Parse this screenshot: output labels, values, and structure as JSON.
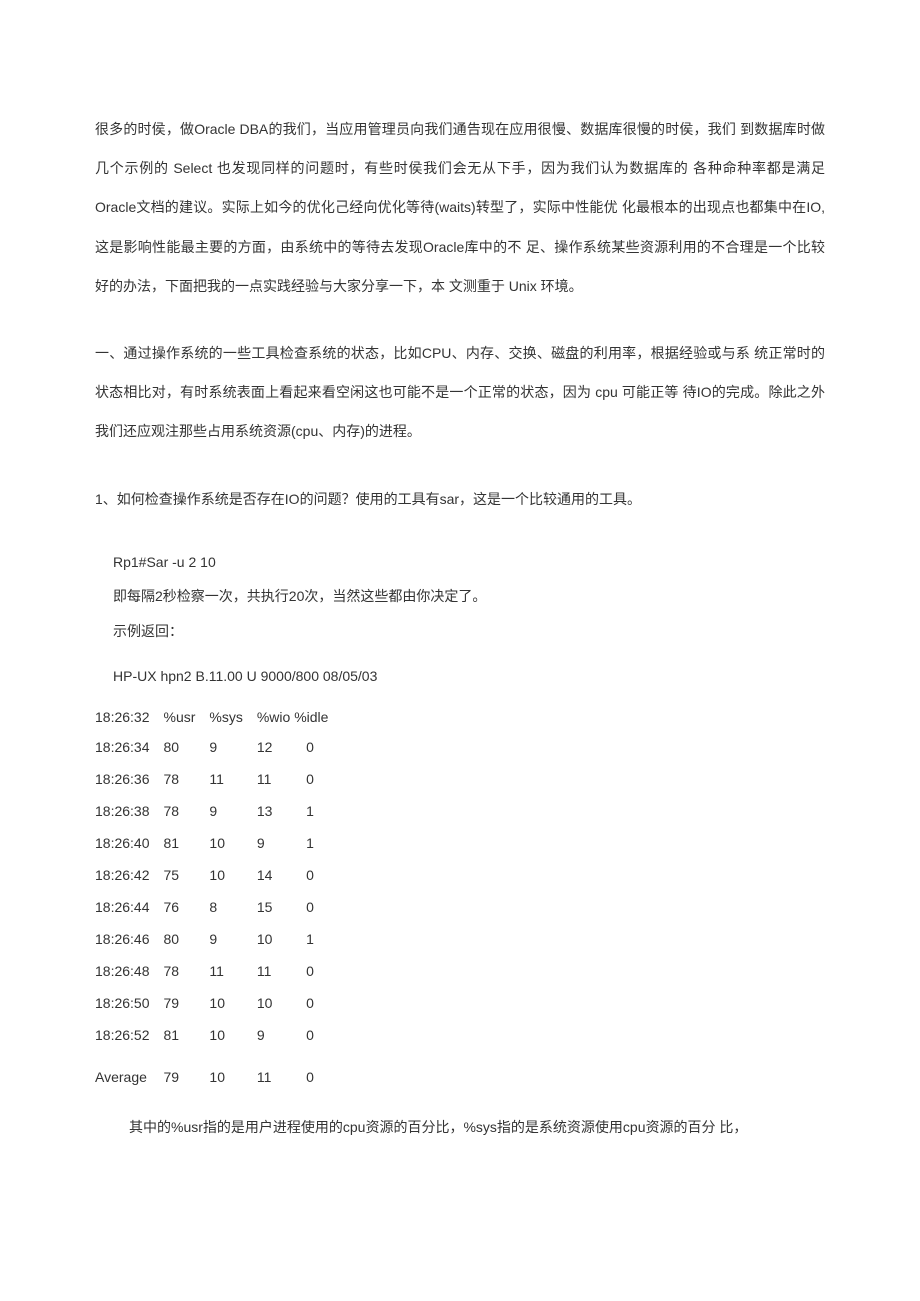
{
  "p1": "很多的时侯，做Oracle DBA的我们，当应用管理员向我们通告现在应用很慢、数据库很慢的时侯，我们  到数据库时做几个示例的  Select 也发现同样的问题时，有些时侯我们会无从下手，因为我们认为数据库的  各种命种率都是满足Oracle文档的建议。实际上如今的优化己经向优化等待(waits)转型了，实际中性能优  化最根本的出现点也都集中在IO,这是影响性能最主要的方面，由系统中的等待去发现Oracle库中的不  足、操作系统某些资源利用的不合理是一个比较好的办法，下面把我的一点实践经验与大家分享一下，本  文测重于  Unix 环境。",
  "p2": "一、通过操作系统的一些工具检查系统的状态，比如CPU、内存、交换、磁盘的利用率，根据经验或与系  统正常时的状态相比对，有时系统表面上看起来看空闲这也可能不是一个正常的状态，因为  cpu 可能正等  待IO的完成。除此之外我们还应观注那些占用系统资源(cpu、内存)的进程。",
  "p3": "1、如何检查操作系统是否存在IO的问题？使用的工具有sar，这是一个比较通用的工具。",
  "cmd": "Rp1#Sar -u 2 10",
  "p4": "即每隔2秒检察一次，共执行20次，当然这些都由你决定了。",
  "p5": "示例返回：",
  "env": "HP-UX hpn2 B.11.00 U 9000/800 08/05/03",
  "headers": [
    "18:26:32",
    "%usr",
    "%sys",
    "%wio %idle",
    ""
  ],
  "rows": [
    [
      "18:26:34",
      "80",
      "9",
      "12",
      "0"
    ],
    [
      "18:26:36",
      "78",
      "11",
      "11",
      "0"
    ],
    [
      "18:26:38",
      "78",
      "9",
      "13",
      "1"
    ],
    [
      "18:26:40",
      "81",
      "10",
      "9",
      "1"
    ],
    [
      "18:26:42",
      "75",
      "10",
      "14",
      "0"
    ],
    [
      "18:26:44",
      "76",
      "8",
      "15",
      "0"
    ],
    [
      "18:26:46",
      "80",
      "9",
      "10",
      "1"
    ],
    [
      "18:26:48",
      "78",
      "11",
      "11",
      "0"
    ],
    [
      "18:26:50",
      "79",
      "10",
      "10",
      "0"
    ],
    [
      "18:26:52",
      "81",
      "10",
      "9",
      "0"
    ]
  ],
  "avg": [
    "Average",
    "79",
    "10",
    "11",
    "0"
  ],
  "p6": "其中的%usr指的是用户进程使用的cpu资源的百分比，%sys指的是系统资源使用cpu资源的百分  比，"
}
